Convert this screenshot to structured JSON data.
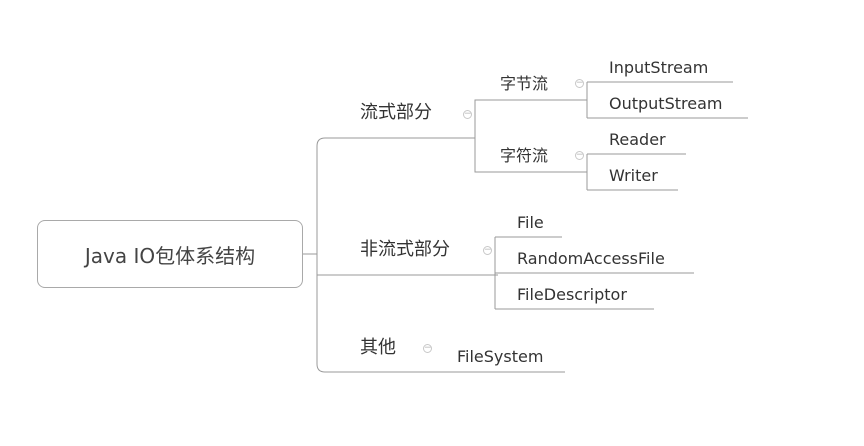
{
  "root": {
    "label": "Java IO包体系结构"
  },
  "branches": {
    "stream": {
      "label": "流式部分",
      "byte": {
        "label": "字节流",
        "items": [
          "InputStream",
          "OutputStream"
        ]
      },
      "char": {
        "label": "字符流",
        "items": [
          "Reader",
          "Writer"
        ]
      }
    },
    "nonstream": {
      "label": "非流式部分",
      "items": [
        "File",
        "RandomAccessFile",
        "FileDescriptor"
      ]
    },
    "other": {
      "label": "其他",
      "items": [
        "FileSystem"
      ]
    }
  },
  "collapse_glyph": "−",
  "colors": {
    "line": "#9a9a9a",
    "text": "#333333",
    "root_border": "#a9a9a9",
    "toggle": "#c0c0c0"
  }
}
